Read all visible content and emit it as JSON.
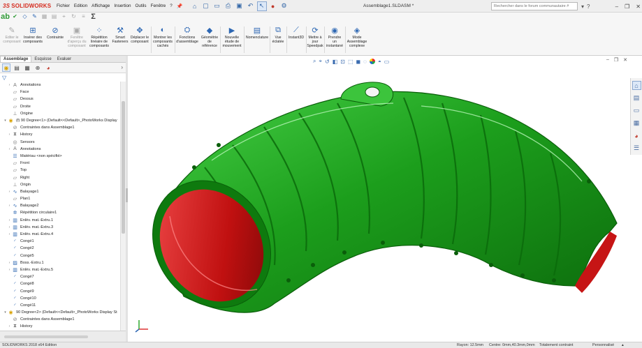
{
  "app": {
    "brand": "SOLIDWORKS",
    "brand_mark": "3S",
    "document_title": "Assemblage1.SLDASM *"
  },
  "menu": [
    {
      "label": "Fichier"
    },
    {
      "label": "Edition"
    },
    {
      "label": "Affichage"
    },
    {
      "label": "Insertion"
    },
    {
      "label": "Outils"
    },
    {
      "label": "Fenêtre"
    }
  ],
  "quick_access": [
    "home-icon",
    "new-document-icon",
    "open-icon",
    "print-icon",
    "save-icon",
    "undo-icon",
    "select-icon",
    "traffic-light-icon",
    "options-icon"
  ],
  "search": {
    "placeholder": "Rechercher dans le forum communautaire"
  },
  "command_manager": {
    "commands": [
      {
        "id": "editer-composant",
        "label": "Editer le\ncomposant",
        "disabled": true
      },
      {
        "id": "inserer-composants",
        "label": "Insérer des\ncomposants",
        "disabled": false
      },
      {
        "id": "contrainte",
        "label": "Contrainte",
        "disabled": false
      },
      {
        "id": "fenetre-apercu",
        "label": "Fenêtre\nd'aperçu du\ncomposant",
        "disabled": true
      },
      {
        "id": "repetition-lineaire",
        "label": "Répétition\nlinéaire de\ncomposants",
        "disabled": false
      },
      {
        "id": "smart-fasteners",
        "label": "Smart\nFasteners",
        "disabled": false
      },
      {
        "id": "deplacer-composant",
        "label": "Déplacer le\ncomposant",
        "disabled": false
      },
      {
        "id": "montrer-caches",
        "label": "Montrer les\ncomposants\ncachés",
        "disabled": false
      },
      {
        "id": "fonctions-assemblage",
        "label": "Fonctions\nd'assemblage",
        "disabled": false
      },
      {
        "id": "geometrie-reference",
        "label": "Géométrie\nde\nréférence",
        "disabled": false
      },
      {
        "id": "nouvelle-etude",
        "label": "Nouvelle\nétude de\nmouvement",
        "disabled": false
      },
      {
        "id": "nomenclature",
        "label": "Nomenclature",
        "disabled": false
      },
      {
        "id": "vue-eclatee",
        "label": "Vue\néclatée",
        "disabled": false
      },
      {
        "id": "instant3d",
        "label": "Instant3D",
        "disabled": false
      },
      {
        "id": "speedpak",
        "label": "Mettre à\njour\nSpeedpak",
        "disabled": false
      },
      {
        "id": "instantane",
        "label": "Prendre\nun\ninstantané",
        "disabled": false
      },
      {
        "id": "assemblage-complexe",
        "label": "Mode\nAssemblage\ncomplexe",
        "disabled": false
      }
    ]
  },
  "feature_manager": {
    "tabs": [
      {
        "label": "Assemblage",
        "active": true
      },
      {
        "label": "Esquisse",
        "active": false
      },
      {
        "label": "Evaluer",
        "active": false
      }
    ],
    "tree": [
      {
        "label": "Annotations",
        "level": 1,
        "icon": "annotation-icon",
        "color": "gray",
        "expand": "right"
      },
      {
        "label": "Face",
        "level": 1,
        "icon": "plane-icon",
        "color": "gray",
        "expand": ""
      },
      {
        "label": "Dessus",
        "level": 1,
        "icon": "plane-icon",
        "color": "gray",
        "expand": ""
      },
      {
        "label": "Droite",
        "level": 1,
        "icon": "plane-icon",
        "color": "gray",
        "expand": ""
      },
      {
        "label": "Origine",
        "level": 1,
        "icon": "origin-icon",
        "color": "gray",
        "expand": ""
      },
      {
        "label": "(f) 90 Degree<1> (Default<<Default>_PhotoWorks Display",
        "level": 0,
        "icon": "part-icon",
        "color": "yellow",
        "expand": "down"
      },
      {
        "label": "Contraintes dans Assemblage1",
        "level": 1,
        "icon": "mate-icon",
        "color": "gray",
        "expand": ""
      },
      {
        "label": "History",
        "level": 1,
        "icon": "history-icon",
        "color": "gray",
        "expand": "right"
      },
      {
        "label": "Sensors",
        "level": 1,
        "icon": "sensor-icon",
        "color": "gray",
        "expand": ""
      },
      {
        "label": "Annotations",
        "level": 1,
        "icon": "annotation-icon",
        "color": "gray",
        "expand": "right"
      },
      {
        "label": "Matériau <non spécifié>",
        "level": 1,
        "icon": "material-icon",
        "color": "blue",
        "expand": ""
      },
      {
        "label": "Front",
        "level": 1,
        "icon": "plane-icon",
        "color": "gray",
        "expand": ""
      },
      {
        "label": "Top",
        "level": 1,
        "icon": "plane-icon",
        "color": "gray",
        "expand": ""
      },
      {
        "label": "Right",
        "level": 1,
        "icon": "plane-icon",
        "color": "gray",
        "expand": ""
      },
      {
        "label": "Origin",
        "level": 1,
        "icon": "origin-icon",
        "color": "gray",
        "expand": ""
      },
      {
        "label": "Balayage1",
        "level": 1,
        "icon": "sweep-icon",
        "color": "blue",
        "expand": "right"
      },
      {
        "label": "Plan1",
        "level": 1,
        "icon": "plane-icon",
        "color": "gray",
        "expand": ""
      },
      {
        "label": "Balayage2",
        "level": 1,
        "icon": "sweep-icon",
        "color": "blue",
        "expand": "right"
      },
      {
        "label": "Répétition circulaire1",
        "level": 1,
        "icon": "circular-pattern-icon",
        "color": "blue",
        "expand": ""
      },
      {
        "label": "Enlèv. mat.-Extru.1",
        "level": 1,
        "icon": "cut-extrude-icon",
        "color": "blue",
        "expand": "right"
      },
      {
        "label": "Enlèv. mat.-Extru.3",
        "level": 1,
        "icon": "cut-extrude-icon",
        "color": "blue",
        "expand": "right"
      },
      {
        "label": "Enlèv. mat.-Extru.4",
        "level": 1,
        "icon": "cut-extrude-icon",
        "color": "blue",
        "expand": "right"
      },
      {
        "label": "Congé1",
        "level": 1,
        "icon": "fillet-icon",
        "color": "blue",
        "expand": ""
      },
      {
        "label": "Congé2",
        "level": 1,
        "icon": "fillet-icon",
        "color": "blue",
        "expand": ""
      },
      {
        "label": "Congé5",
        "level": 1,
        "icon": "fillet-icon",
        "color": "blue",
        "expand": ""
      },
      {
        "label": "Boss.-Extru.1",
        "level": 1,
        "icon": "boss-extrude-icon",
        "color": "blue",
        "expand": "right"
      },
      {
        "label": "Enlèv. mat.-Extru.5",
        "level": 1,
        "icon": "cut-extrude-icon",
        "color": "blue",
        "expand": "right"
      },
      {
        "label": "Congé7",
        "level": 1,
        "icon": "fillet-icon",
        "color": "blue",
        "expand": ""
      },
      {
        "label": "Congé8",
        "level": 1,
        "icon": "fillet-icon",
        "color": "blue",
        "expand": ""
      },
      {
        "label": "Congé9",
        "level": 1,
        "icon": "fillet-icon",
        "color": "blue",
        "expand": ""
      },
      {
        "label": "Congé10",
        "level": 1,
        "icon": "fillet-icon",
        "color": "blue",
        "expand": ""
      },
      {
        "label": "Congé11",
        "level": 1,
        "icon": "fillet-icon",
        "color": "blue",
        "expand": ""
      },
      {
        "label": "90 Degree<2> (Default<<Default>_PhotoWorks Display St",
        "level": 0,
        "icon": "part-icon",
        "color": "yellow",
        "expand": "down"
      },
      {
        "label": "Contraintes dans Assemblage1",
        "level": 1,
        "icon": "mate-icon",
        "color": "gray",
        "expand": ""
      },
      {
        "label": "History",
        "level": 1,
        "icon": "history-icon",
        "color": "gray",
        "expand": "right"
      }
    ]
  },
  "status_bar": {
    "edition": "SOLIDWORKS 2018 x64 Edition",
    "rayon": "Rayon: 12.5mm",
    "centre": "Centre: 0mm,40.3mm,0mm",
    "contrainte": "Totalement contraint",
    "unit": "Personnalisé"
  },
  "colors": {
    "part_green": "#1fa31f",
    "part_red": "#d11c1c",
    "accent": "#2d67b3",
    "brand": "#d52b1e"
  }
}
